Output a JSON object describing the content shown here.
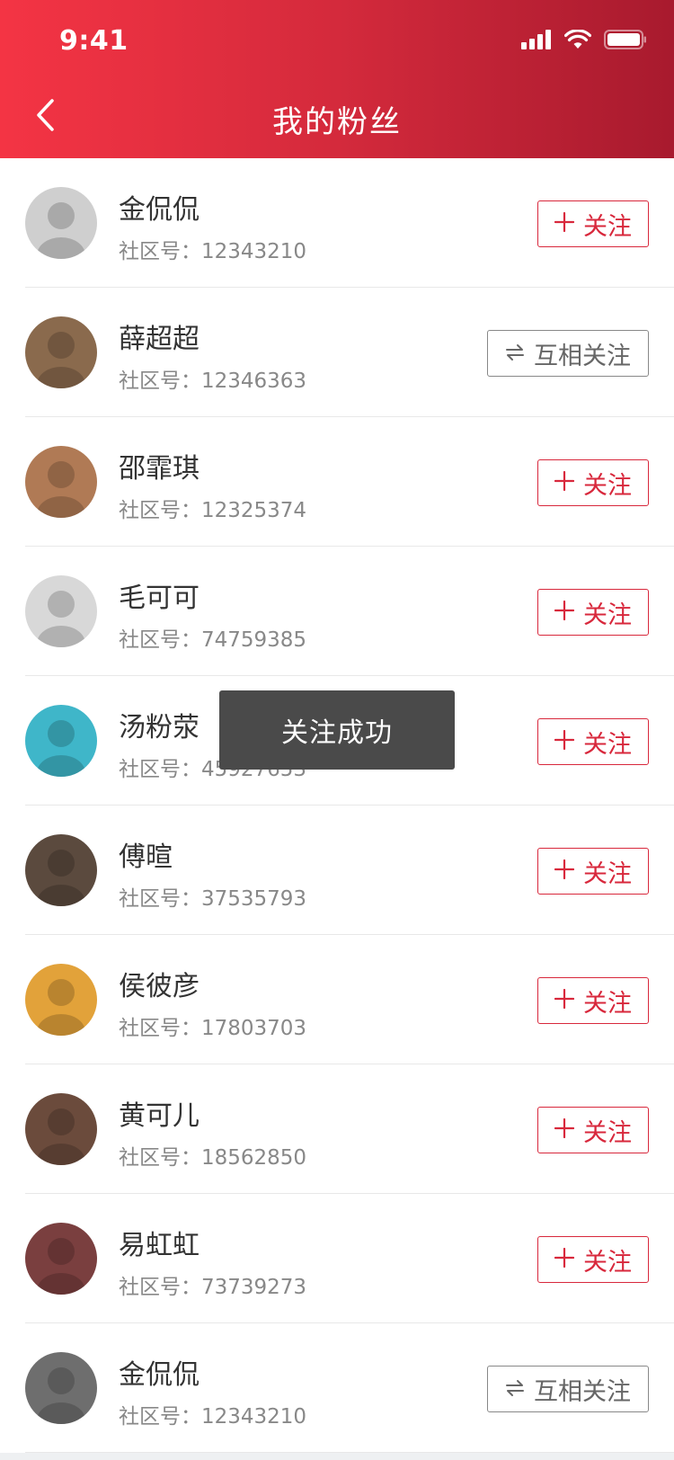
{
  "status_bar": {
    "time": "9:41"
  },
  "header": {
    "title": "我的粉丝"
  },
  "fans": [
    {
      "name": "金侃侃",
      "id_label": "社区号：12343210",
      "button": "关注",
      "state": "follow",
      "avatar_color": "#cfcfcf"
    },
    {
      "name": "薛超超",
      "id_label": "社区号：12346363",
      "button": "互相关注",
      "state": "mutual",
      "avatar_color": "#8a6a4d"
    },
    {
      "name": "邵霏琪",
      "id_label": "社区号：12325374",
      "button": "关注",
      "state": "follow",
      "avatar_color": "#b07a55"
    },
    {
      "name": "毛可可",
      "id_label": "社区号：74759385",
      "button": "关注",
      "state": "follow",
      "avatar_color": "#d8d8d8"
    },
    {
      "name": "汤粉荥",
      "id_label": "社区号：45927653",
      "button": "关注",
      "state": "follow",
      "avatar_color": "#3fb6c9"
    },
    {
      "name": "傅暄",
      "id_label": "社区号：37535793",
      "button": "关注",
      "state": "follow",
      "avatar_color": "#5b4a3e"
    },
    {
      "name": "侯彼彦",
      "id_label": "社区号：17803703",
      "button": "关注",
      "state": "follow",
      "avatar_color": "#e2a23a"
    },
    {
      "name": "黄可儿",
      "id_label": "社区号：18562850",
      "button": "关注",
      "state": "follow",
      "avatar_color": "#6b4b3c"
    },
    {
      "name": "易虹虹",
      "id_label": "社区号：73739273",
      "button": "关注",
      "state": "follow",
      "avatar_color": "#7a3f3f"
    },
    {
      "name": "金侃侃",
      "id_label": "社区号：12343210",
      "button": "互相关注",
      "state": "mutual",
      "avatar_color": "#6e6e6e"
    }
  ],
  "toast": {
    "text": "关注成功"
  },
  "colors": {
    "accent": "#d8283c",
    "header_start": "#f43444",
    "header_end": "#a81a2e"
  },
  "icons": {
    "back": "chevron-left-icon",
    "follow": "plus-icon",
    "mutual": "exchange-icon"
  }
}
